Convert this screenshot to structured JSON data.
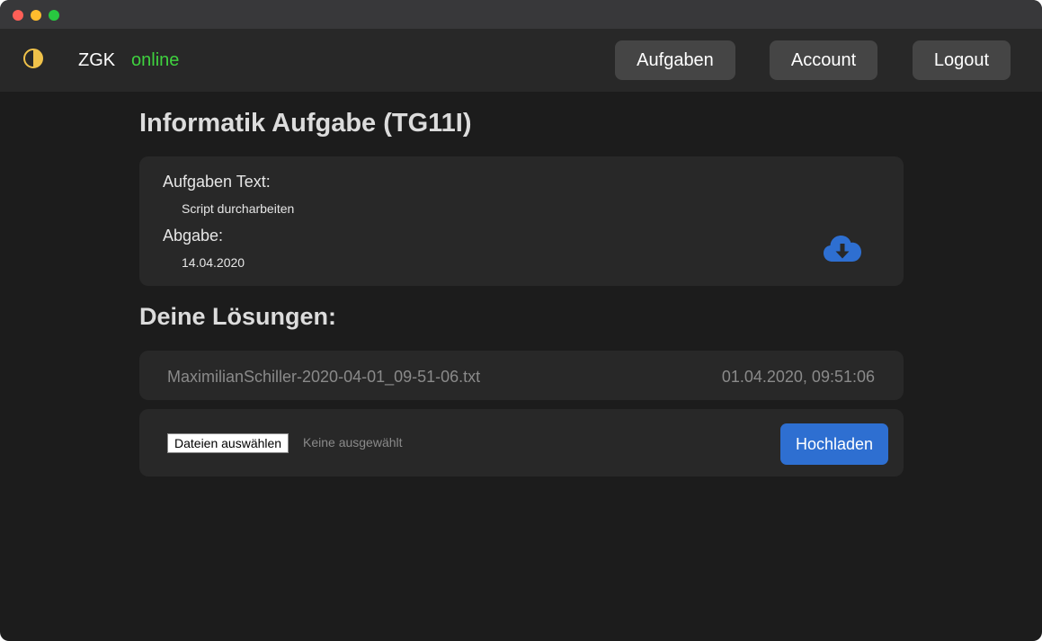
{
  "window": {
    "controls": [
      "close",
      "minimize",
      "maximize"
    ]
  },
  "navbar": {
    "theme_icon": "half-circle-contrast-icon",
    "brand": "ZGK",
    "status": "online",
    "status_color": "#3fd13f",
    "buttons": {
      "tasks": "Aufgaben",
      "account": "Account",
      "logout": "Logout"
    }
  },
  "task": {
    "title": "Informatik Aufgabe (TG11I)",
    "text_label": "Aufgaben Text:",
    "text_value": "Script durcharbeiten",
    "due_label": "Abgabe:",
    "due_value": "14.04.2020",
    "download_icon": "cloud-download-icon",
    "accent_color": "#2e6fd1"
  },
  "solutions": {
    "title": "Deine Lösungen:",
    "files": [
      {
        "name": "MaximilianSchiller-2020-04-01_09-51-06.txt",
        "date": "01.04.2020, 09:51:06"
      }
    ]
  },
  "upload": {
    "choose_label": "Dateien auswählen",
    "no_file_text": "Keine ausgewählt",
    "submit_label": "Hochladen"
  }
}
